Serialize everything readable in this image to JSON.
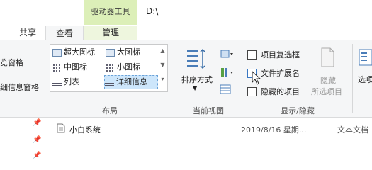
{
  "title_bar": {
    "context_tab": "驱动器工具",
    "path": "D:\\"
  },
  "tabs": [
    {
      "label": "共享"
    },
    {
      "label": "查看"
    },
    {
      "label": "管理"
    }
  ],
  "ribbon": {
    "pane_group": {
      "items": [
        "览窗格",
        "细信息窗格"
      ]
    },
    "layout_group": {
      "label": "布局",
      "items": [
        "超大图标",
        "大图标",
        "中图标",
        "小图标",
        "列表",
        "详细信息"
      ],
      "selected": "详细信息"
    },
    "current_view_group": {
      "label": "当前视图",
      "sort_label": "排序方式"
    },
    "show_hide_group": {
      "label": "显示/隐藏",
      "checkboxes": [
        "项目复选框",
        "文件扩展名",
        "隐藏的项目"
      ],
      "hide_button_label": "隐藏",
      "hide_button_sublabel": "所选项目"
    },
    "options_label": "选项"
  },
  "file_list": {
    "rows": [
      {
        "name": "小白系统",
        "date": "2019/8/16 星期...",
        "type": "文本文档"
      }
    ]
  }
}
